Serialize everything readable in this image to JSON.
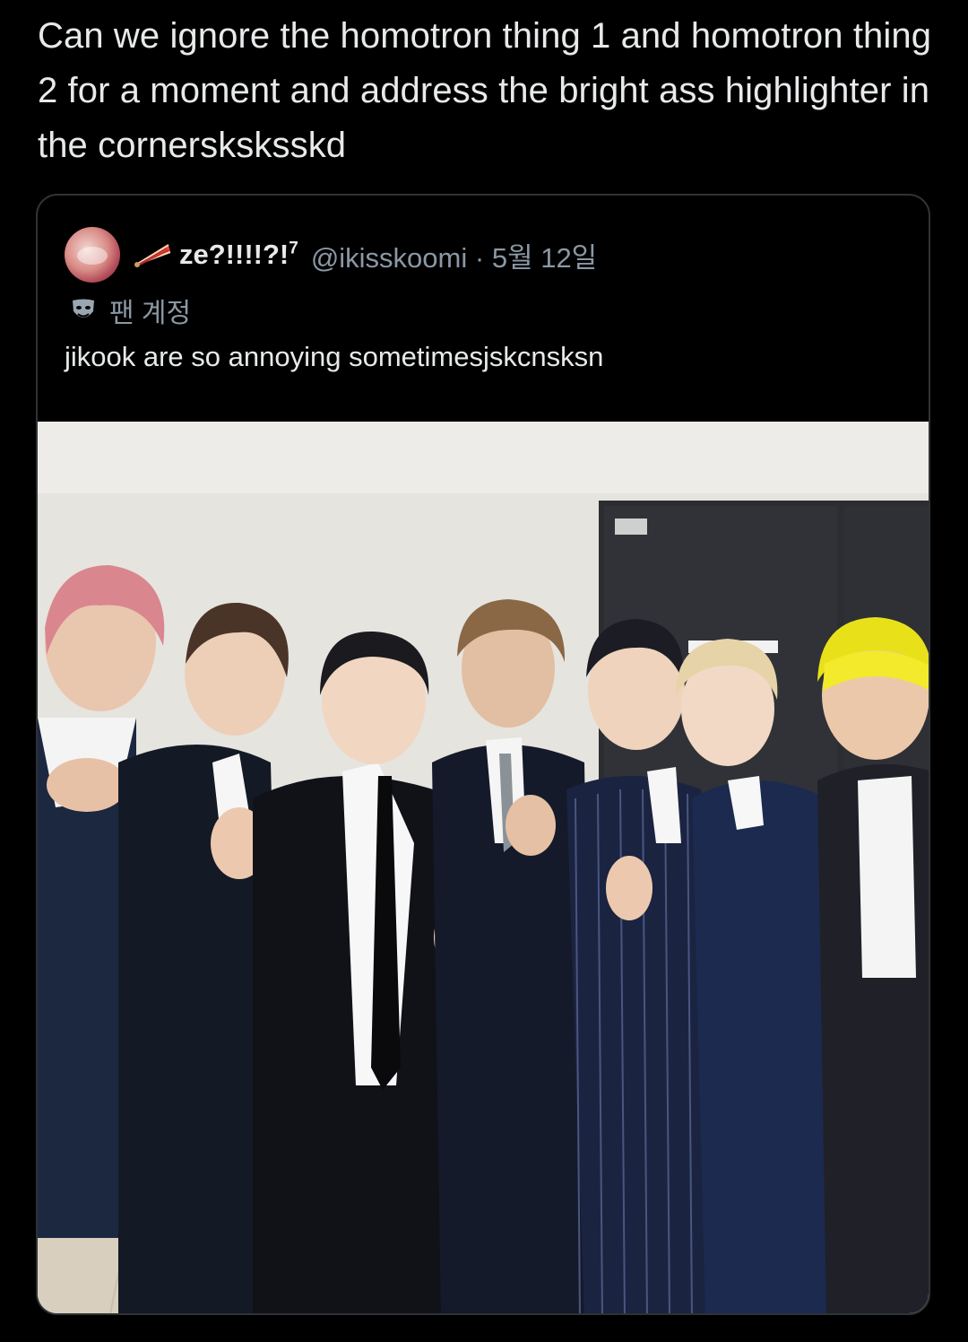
{
  "tweet": {
    "text": "Can we ignore the homotron thing 1 and homotron thing 2 for a moment and address the bright ass highlighter in the cornersksksskd"
  },
  "quoted_tweet": {
    "display_name": "ze?!!!!?!",
    "display_name_sup": "7",
    "handle": "@ikisskoomi",
    "separator": "·",
    "date": "5월 12일",
    "badge_label": "팬 계정",
    "text": "jikook are so annoying sometimesjskcnsksn",
    "image": {
      "description_icon": "group-photo",
      "people_count": 7
    }
  },
  "colors": {
    "background": "#000000",
    "primary_text": "#e7e9ea",
    "secondary_text": "#8b98a5",
    "border": "#2f3336",
    "hair_pink": "#d9868f",
    "hair_yellow": "#e8e11a"
  },
  "icons": {
    "fan": "folding-fan-icon",
    "badge": "theater-mask-icon"
  }
}
